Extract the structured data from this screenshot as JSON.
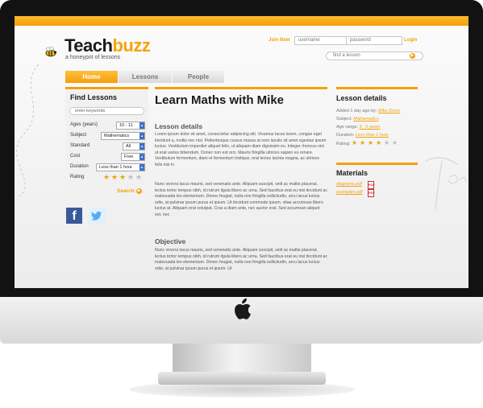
{
  "site": {
    "logo_part1": "Teach",
    "logo_part2": "buzz",
    "tagline": "a honeypot of lessons"
  },
  "header": {
    "join_label": "Join Now",
    "username_placeholder": "username",
    "password_placeholder": "password",
    "login_label": "Login",
    "find_placeholder": "find a lesson"
  },
  "nav": {
    "tabs": [
      {
        "label": "Home",
        "active": true
      },
      {
        "label": "Lessons",
        "active": false
      },
      {
        "label": "People",
        "active": false
      }
    ]
  },
  "sidebar": {
    "title": "Find Lessons",
    "keywords_placeholder": "enter keywords",
    "filters": [
      {
        "label": "Ages (years)",
        "value": "10 - 11"
      },
      {
        "label": "Subject",
        "value": "Mathematics"
      },
      {
        "label": "Standard",
        "value": "All"
      },
      {
        "label": "Cost",
        "value": "Free"
      },
      {
        "label": "Duration",
        "value": "Less than 1 hour"
      }
    ],
    "rating_label": "Rating",
    "rating": 3,
    "rating_max": 5,
    "search_label": "Search"
  },
  "social": {
    "facebook_icon": "facebook-icon",
    "twitter_icon": "twitter-bird-icon"
  },
  "main": {
    "title": "Learn Maths with Mike",
    "details_heading": "Lesson details",
    "p1": "Lorem ipsum dolor sit amet, consectetur adipiscing elit. Vivamus lacus lorem, congue eget tincidunt a, mollis nec nisl. Pellentesque cursus massa at sem iaculis sit amet egestas ipsum luctus. Vestibulum imperdiet aliquet felis, ut aliquam diam dignissim eu. Integer rhoncus nisl ut erat varius bibendum. Donec non est orci. Mauris fringilla ultrices sapien eu ornare. Vestibulum fermentum, diam et fermentum tristique, erat lectus lacinia magna, ac ultrices felis nisi in",
    "p2": "Nunc viverra lacus mauris, sed venenatis ante. Aliquam suscipit, velit ac mattis placerat, lectus tortor tempus nibh, id rutrum ligula libero ac urna. Sed faucibus erat eu nisi tincidunt ac malesuada leo elementum. Donec feugiat, nulla non fringilla sollicitudin, arcu lacus luctus odio, at pulvinar ipsum purus et ipsum. Ut tincidunt commodo ipsum, vitae accumsan libero luctus at. Aliquam erat volutpat. Cras a diam ante, nec auctor erat. Sed accumsan aliquet est, nec",
    "objective_heading": "Objective",
    "p3": "Nunc viverra lacus mauris, sed venenatis ante. Aliquam suscipit, velit ac mattis placerat, lectus tortor tempus nibh, id rutrum ligula libero ac urna. Sed faucibus erat eu nisi tincidunt ac malesuada leo elementum. Donec feugiat, nulla non fringilla sollicitudin, arcu lacus luctus odio, at pulvinar ipsum purus et ipsum. Ut"
  },
  "right": {
    "details_heading": "Lesson details",
    "added_prefix": "Added 1 day ago by:",
    "author": "Mike Dixon",
    "subject_prefix": "Subject:",
    "subject": "Mathematics",
    "age_prefix": "Age range:",
    "age": "3 - 6 years",
    "duration_prefix": "Duration:",
    "duration": "Less than 1 hour",
    "rating_label": "Rating:",
    "rating": 4,
    "rating_max": 6,
    "materials_heading": "Materials",
    "materials": [
      "diagrams.pdf",
      "examples.pdf"
    ],
    "pdf_icon_label": "PDF"
  },
  "colors": {
    "accent": "#f59f0a",
    "text_dark": "#1a1a1a",
    "facebook": "#3b5998",
    "twitter": "#55acee"
  }
}
